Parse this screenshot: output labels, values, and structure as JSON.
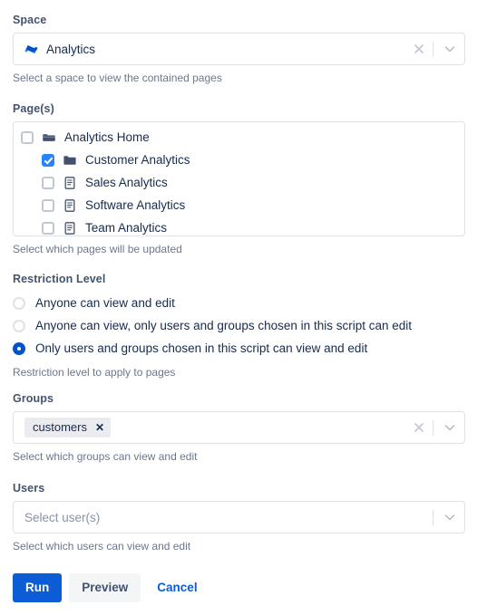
{
  "space": {
    "label": "Space",
    "icon": "confluence-space-icon",
    "value": "Analytics",
    "help": "Select a space to view the contained pages",
    "clear_icon": "clear-icon",
    "dropdown_icon": "chevron-down-icon"
  },
  "pages": {
    "label": "Page(s)",
    "help": "Select which pages will be updated",
    "items": [
      {
        "label": "Analytics Home",
        "icon": "folder-open-icon",
        "checked": false,
        "level": 0
      },
      {
        "label": "Customer Analytics",
        "icon": "folder-icon",
        "checked": true,
        "level": 1
      },
      {
        "label": "Sales Analytics",
        "icon": "page-icon",
        "checked": false,
        "level": 1
      },
      {
        "label": "Software Analytics",
        "icon": "page-icon",
        "checked": false,
        "level": 1
      },
      {
        "label": "Team Analytics",
        "icon": "page-icon",
        "checked": false,
        "level": 1
      }
    ]
  },
  "restriction": {
    "label": "Restriction Level",
    "help": "Restriction level to apply to pages",
    "options": [
      {
        "label": "Anyone can view and edit",
        "selected": false
      },
      {
        "label": "Anyone can view, only users and groups chosen in this script can edit",
        "selected": false
      },
      {
        "label": "Only users and groups chosen in this script can view and edit",
        "selected": true
      }
    ]
  },
  "groups": {
    "label": "Groups",
    "help": "Select which groups can view and edit",
    "chips": [
      {
        "label": "customers",
        "remove_icon": "chip-remove-icon"
      }
    ],
    "clear_icon": "clear-icon",
    "dropdown_icon": "chevron-down-icon"
  },
  "users": {
    "label": "Users",
    "help": "Select which users can view and edit",
    "placeholder": "Select user(s)",
    "value": "",
    "dropdown_icon": "chevron-down-icon"
  },
  "actions": {
    "run_label": "Run",
    "preview_label": "Preview",
    "cancel_label": "Cancel"
  },
  "colors": {
    "primary": "#0B5CD5",
    "checkbox": "#2684FF",
    "radio_selected": "#0052CC",
    "label": "#44546F",
    "help": "#6B778C",
    "border": "#DFE1E6",
    "chip_bg": "#EBECF0",
    "icon_slate": "#42526E"
  }
}
